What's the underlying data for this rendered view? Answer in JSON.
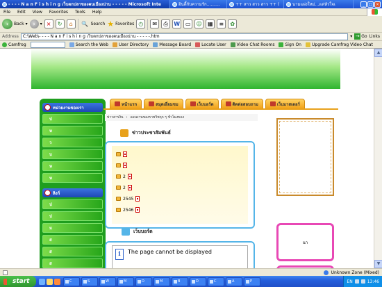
{
  "window": {
    "tabs": [
      {
        "title": "- - - - N a n F i s h i n g เว็บตกปลาของคนเมืองน่าน - - - - - Microsoft Inte",
        "active": true
      },
      {
        "title": "อินดี้กับความรัก..........",
        "active": false
      },
      {
        "title": "++ สาว สาว สาว ++ (",
        "active": false
      },
      {
        "title": "นามแฝงใหม่...แต่หัวใจเ",
        "active": false
      }
    ]
  },
  "menubar": [
    "File",
    "Edit",
    "View",
    "Favorites",
    "Tools",
    "Help"
  ],
  "toolbar": {
    "back_label": "Back",
    "search_label": "Search",
    "favorites_label": "Favorites"
  },
  "addressbar": {
    "label": "Address",
    "url": "C:\\Web\\- - - - N a n F i s h i n g เว็บตกปลาของคนเมืองน่าน - - - - -.htm",
    "go_label": "Go",
    "links_label": "Links"
  },
  "camfrog": {
    "brand": "Camfrog",
    "items": [
      "Search the Web",
      "User Directory",
      "Message Board",
      "Locate User",
      "Video Chat Rooms",
      "Sign On",
      "Upgrade Camfrog Video Chat"
    ]
  },
  "nav_tabs": [
    "หน้าแรก",
    "สมุดเยี่ยมชม",
    "เว็บบอร์ด",
    "ติดต่อสอบถาม",
    "เว็บมาสเตอร์"
  ],
  "sidebar": {
    "section1_title": "หน่วยงานของเรา",
    "section1_items": [
      "ป",
      "ห",
      "ว",
      "บ",
      "ห",
      "ห"
    ],
    "section2_title": "ลิงก์",
    "section2_items": [
      "ป",
      "ป",
      "ม",
      "ส",
      "ส",
      "ส"
    ]
  },
  "breadcrumb": {
    "home": "ข่าวสารงิน",
    "path": "แผนงานของราชวิชฤก ๆ ชั่วโมงของ"
  },
  "news": {
    "title": "ข่าวประชาสัมพันธ์",
    "rows": [
      "",
      "",
      "2",
      "2",
      "2545",
      "2546"
    ]
  },
  "webboard": {
    "title": "เว็บบอร์ด",
    "message": "The page cannot be displayed"
  },
  "right_panel": {
    "pink_text": "นา"
  },
  "statusbar": {
    "zone": "Unknown Zone (Mixed)"
  },
  "taskbar": {
    "start_label": "start",
    "tasks": [
      "C",
      "S",
      "W",
      "M",
      "D",
      "M",
      "B",
      "D",
      "C",
      "A",
      "P"
    ],
    "lang": "EN",
    "time": "13:46"
  }
}
